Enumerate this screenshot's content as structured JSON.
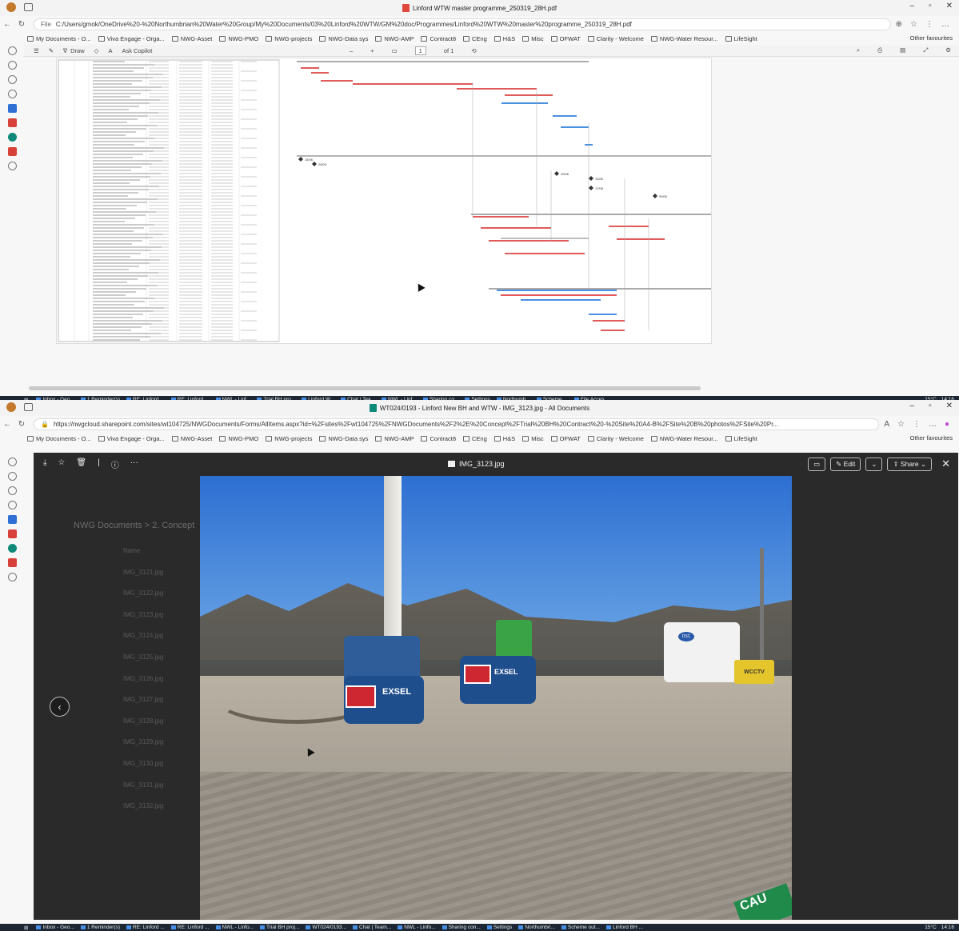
{
  "win1": {
    "title": "Linford WTW master programme_250319_28H.pdf",
    "url_label": "File",
    "url": "C:/Users/gmok/OneDrive%20-%20Northumbrian%20Water%20Group/My%20Documents/03%20Linford%20WTW/GM%20doc/Programmes/Linford%20WTW%20master%20programme_250319_28H.pdf",
    "favourites": [
      "My Documents - O...",
      "Viva Engage - Orga...",
      "NWG-Asset",
      "NWG-PMO",
      "NWG-projects",
      "NWG-Data sys",
      "NWG-AMP",
      "Contract8",
      "CEng",
      "H&S",
      "Misc",
      "OFWAT",
      "Clarity - Welcome",
      "NWG-Water Resour...",
      "LifeSight"
    ],
    "other_favourites": "Other favourites",
    "pdf_toolbar": {
      "draw": "Draw",
      "ask_copilot": "Ask Copilot",
      "page_current": "1",
      "page_total": "of 1"
    },
    "gantt_milestones": [
      "15/06",
      "28/09",
      "29/06",
      "11/08",
      "17/08",
      "05/05"
    ]
  },
  "taskbar1": {
    "items": [
      "Inbox - Geo...",
      "1 Reminder(s)",
      "RE: Linford ...",
      "RE: Linford ...",
      "NWL - Linf...",
      "Trial BH pro...",
      "Linford W...",
      "Chat | Tea...",
      "NWL - Linf...",
      "Sharing co...",
      "Settings",
      "Northumb...",
      "Scheme ...",
      "File Acces..."
    ],
    "temp": "15°C",
    "time": "14:16"
  },
  "win2": {
    "title": "WT024/0193 - Linford New BH and WTW - IMG_3123.jpg - All Documents",
    "url": "https://nwgcloud.sharepoint.com/sites/wt104725/NWGDocuments/Forms/AllItems.aspx?id=%2Fsites%2Fwt104725%2FNWGDocuments%2F2%2E%20Concept%2FTrial%20BH%20Contract%20-%20Site%20A4-B%2FSite%20B%20photos%2FSite%20Pr...",
    "favourites": [
      "My Documents - O...",
      "Viva Engage - Orga...",
      "NWG-Asset",
      "NWG-PMO",
      "NWG-projects",
      "NWG-Data sys",
      "NWG-AMP",
      "Contract8",
      "CEng",
      "H&S",
      "Misc",
      "OFWAT",
      "Clarity - Welcome",
      "NWG-Water Resour...",
      "LifeSight"
    ],
    "other_favourites": "Other favourites",
    "viewer": {
      "file_name": "IMG_3123.jpg",
      "edit_label": "Edit",
      "share_label": "Share",
      "bg_library_title": "NWG Documents > 2. Concept",
      "bg_name_header": "Name",
      "bg_files": [
        "IMG_3121.jpg",
        "IMG_3122.jpg",
        "IMG_3123.jpg",
        "IMG_3124.jpg",
        "IMG_3125.jpg",
        "IMG_3126.jpg",
        "IMG_3127.jpg",
        "IMG_3128.jpg",
        "IMG_3129.jpg",
        "IMG_3130.jpg",
        "IMG_3131.jpg",
        "IMG_3132.jpg"
      ],
      "photo_labels": {
        "exsel_1": "EXSEL",
        "exsel_2": "EXSEL",
        "wcctv": "WCCTV",
        "dsc": "DSC",
        "sign": "CAU"
      }
    }
  },
  "taskbar2": {
    "items": [
      "Inbox - Geo...",
      "1 Reminder(s)",
      "RE: Linford ...",
      "RE: Linford ...",
      "NWL - Linfo...",
      "Trial BH proj...",
      "WT024/0193...",
      "Chat | Team...",
      "NWL - Linfo...",
      "Sharing con...",
      "Settings",
      "Northumbri...",
      "Scheme out...",
      "Linford BH ..."
    ],
    "temp": "15°C",
    "time": "14:16"
  }
}
